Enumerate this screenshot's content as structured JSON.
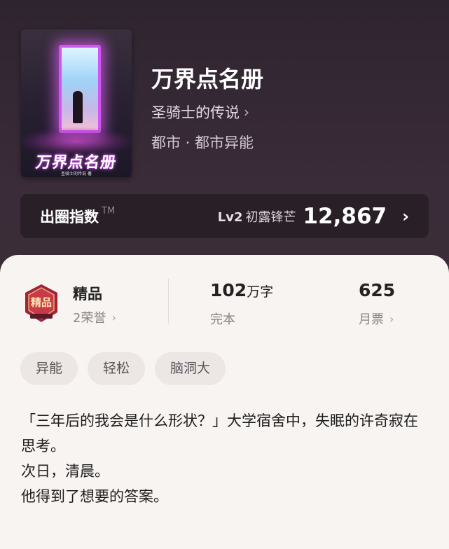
{
  "book": {
    "title": "万界点名册",
    "author": "圣骑士的传说",
    "genre": "都市 · 都市异能",
    "cover": {
      "title": "万界点名册",
      "author_line": "圣骑士的传说 著",
      "accent_color": "#d254f2"
    }
  },
  "index": {
    "label": "出圈指数",
    "tm": "TM",
    "level": "Lv2",
    "level_name": "初露锋芒",
    "score": "12,867"
  },
  "stats": {
    "quality": {
      "title": "精品",
      "honors": "2荣誉",
      "badge_text": "精品"
    },
    "words": {
      "value": "102",
      "unit": "万字",
      "status": "完本"
    },
    "votes": {
      "value": "625",
      "label": "月票"
    }
  },
  "tags": [
    "异能",
    "轻松",
    "脑洞大"
  ],
  "intro": [
    "「三年后的我会是什么形状？」大学宿舍中，失眠的许奇寂在思考。",
    "次日，清晨。",
    "他得到了想要的答案。"
  ],
  "icons": {
    "chevron": "chevron-right-icon",
    "badge": "quality-badge-icon"
  }
}
